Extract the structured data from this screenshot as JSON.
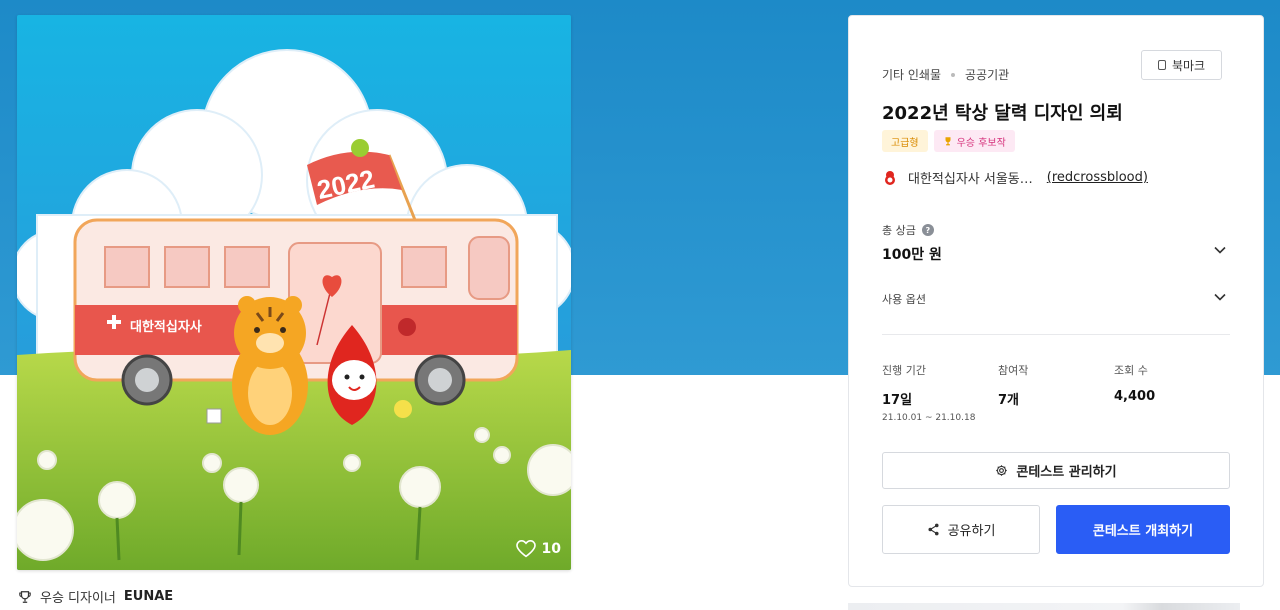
{
  "artwork": {
    "flag_text": "2022",
    "bus_label": "대한적십자사",
    "like_count": "10"
  },
  "winner": {
    "prefix": "우승 디자이너",
    "name": "EUNAE"
  },
  "panel": {
    "breadcrumb": [
      "기타 인쇄물",
      "공공기관"
    ],
    "bookmark_label": "북마크",
    "title": "2022년 탁상 달력 디자인 의뢰",
    "badges": {
      "premium": "고급형",
      "candidate": "우승 후보작"
    },
    "host": {
      "name": "대한적십자사 서울동…",
      "handle": "(redcrossblood)"
    },
    "prize": {
      "label": "총 상금",
      "help": "?",
      "value": "100만 원"
    },
    "usage_label": "사용 옵션",
    "stats": {
      "period": {
        "label": "진행 기간",
        "value": "17일",
        "range": "21.10.01 ~ 21.10.18"
      },
      "entries": {
        "label": "참여작",
        "value": "7개"
      },
      "views": {
        "label": "조회 수",
        "value": "4,400"
      }
    },
    "buttons": {
      "manage": "콘테스트 관리하기",
      "share": "공유하기",
      "host": "콘테스트 개최하기"
    }
  },
  "colors": {
    "header_band": "#1d8ac8",
    "primary_button": "#2a5df5",
    "premium_badge_text": "#d98a00",
    "candidate_badge_text": "#d6337d"
  }
}
